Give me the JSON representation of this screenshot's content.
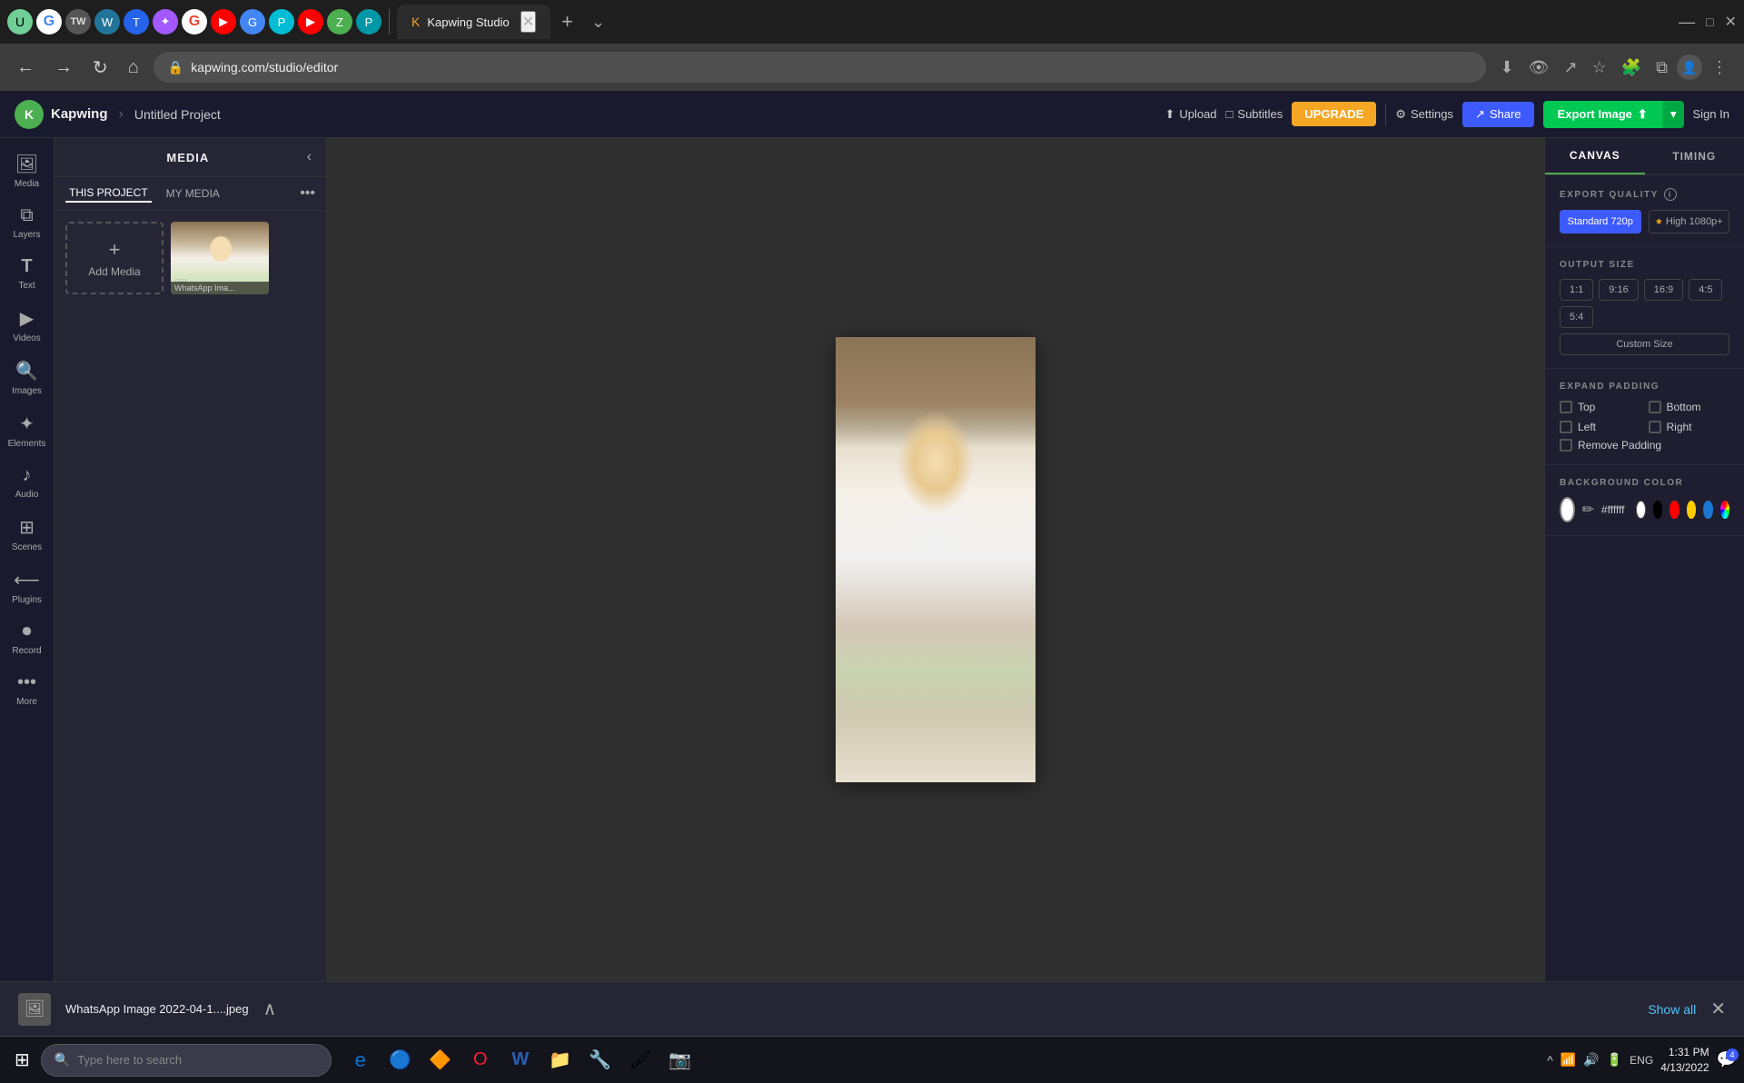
{
  "browser": {
    "tabs": [
      {
        "label": "Kapwing Studio",
        "active": true,
        "favicon": "K"
      }
    ],
    "url": "kapwing.com/studio/editor",
    "new_tab_label": "+",
    "arrow_label": "⌄"
  },
  "nav": {
    "back": "←",
    "forward": "→",
    "refresh": "↻",
    "home": "⌂",
    "lock_icon": "🔒"
  },
  "header": {
    "logo": "K",
    "app_name": "Kapwing",
    "breadcrumb_sep": "›",
    "project_name": "Untitled Project",
    "upload_label": "Upload",
    "subtitles_label": "Subtitles",
    "upgrade_label": "UPGRADE",
    "settings_label": "Settings",
    "share_label": "Share",
    "export_label": "Export Image",
    "signin_label": "Sign In"
  },
  "sidebar": {
    "items": [
      {
        "id": "media",
        "icon": "🖼",
        "label": "Media"
      },
      {
        "id": "layers",
        "icon": "⧉",
        "label": "Layers"
      },
      {
        "id": "text",
        "icon": "T",
        "label": "Text"
      },
      {
        "id": "videos",
        "icon": "▶",
        "label": "Videos"
      },
      {
        "id": "images",
        "icon": "🔍",
        "label": "Images"
      },
      {
        "id": "elements",
        "icon": "✦",
        "label": "Elements"
      },
      {
        "id": "audio",
        "icon": "♪",
        "label": "Audio"
      },
      {
        "id": "scenes",
        "icon": "⊞",
        "label": "Scenes"
      },
      {
        "id": "plugins",
        "icon": "⟵",
        "label": "Plugins"
      },
      {
        "id": "record",
        "icon": "⏺",
        "label": "Record"
      },
      {
        "id": "more",
        "icon": "•••",
        "label": "More"
      }
    ]
  },
  "media_panel": {
    "title": "MEDIA",
    "tab_project": "THIS PROJECT",
    "tab_my_media": "MY MEDIA",
    "add_media_label": "Add Media",
    "add_media_plus": "+",
    "media_items": [
      {
        "label": "WhatsApp Ima..."
      }
    ]
  },
  "right_panel": {
    "tab_canvas": "CANVAS",
    "tab_timing": "TIMING",
    "export_quality_label": "EXPORT QUALITY",
    "export_info": "i",
    "quality_standard": "Standard 720p",
    "quality_high": "★ High 1080p+",
    "output_size_label": "OUTPUT SIZE",
    "sizes": [
      "1:1",
      "9:16",
      "16:9",
      "4:5",
      "5:4"
    ],
    "custom_size_label": "Custom Size",
    "expand_padding_label": "EXPAND PADDING",
    "padding_options": [
      {
        "label": "Top"
      },
      {
        "label": "Bottom"
      },
      {
        "label": "Left"
      },
      {
        "label": "Right"
      }
    ],
    "remove_padding_label": "Remove Padding",
    "bg_color_label": "BACKGROUND COLOR",
    "bg_color_hex": "#ffffff",
    "bg_colors": [
      "#ffffff",
      "#000000",
      "#ff0000",
      "#ffcc00",
      "#1976d2",
      "#4caf50"
    ]
  },
  "bottom_bar": {
    "file_name": "WhatsApp Image 2022-04-1....jpeg",
    "show_all_label": "Show all"
  },
  "taskbar": {
    "start_icon": "⊞",
    "search_placeholder": "Type here to search",
    "search_icon": "🔍",
    "apps": [
      {
        "icon": "🌐",
        "label": "Edge"
      },
      {
        "icon": "🔵",
        "label": "Chrome"
      },
      {
        "icon": "🔶",
        "label": "Explorer"
      },
      {
        "icon": "🔴",
        "label": "Opera"
      },
      {
        "icon": "📝",
        "label": "Word"
      },
      {
        "icon": "📁",
        "label": "Files"
      },
      {
        "icon": "🔧",
        "label": "Tool1"
      },
      {
        "icon": "🖌",
        "label": "Paint"
      },
      {
        "icon": "📷",
        "label": "Camera"
      }
    ],
    "systray": {
      "hide_icon": "^",
      "network": "📶",
      "volume": "🔊",
      "battery": "🔋"
    },
    "clock": "1:31 PM",
    "date": "4/13/2022",
    "lang": "ENG",
    "notification": "4"
  }
}
